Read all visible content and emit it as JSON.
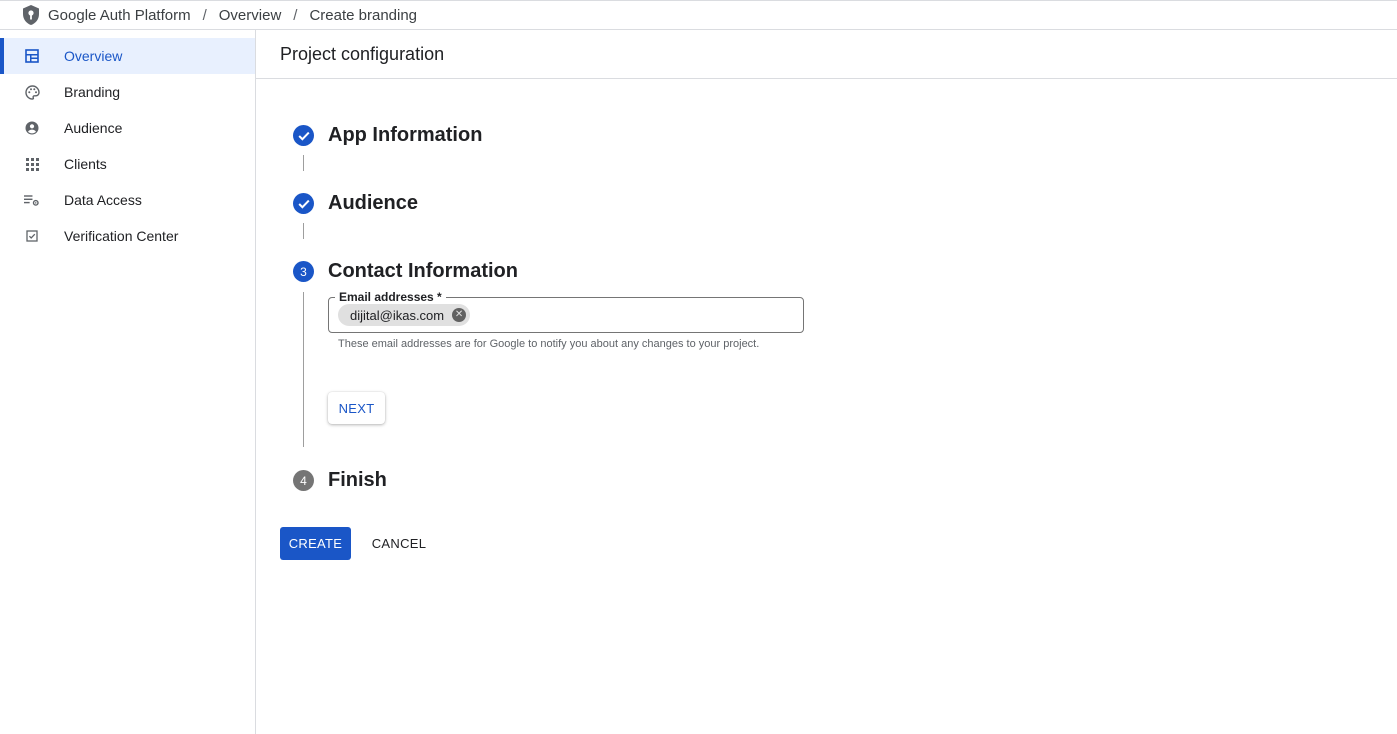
{
  "breadcrumb": {
    "items": [
      "Google Auth Platform",
      "Overview",
      "Create branding"
    ],
    "separator": "/"
  },
  "sidebar": {
    "items": [
      {
        "label": "Overview",
        "icon": "dashboard-icon",
        "active": true
      },
      {
        "label": "Branding",
        "icon": "palette-icon",
        "active": false
      },
      {
        "label": "Audience",
        "icon": "account-circle-icon",
        "active": false
      },
      {
        "label": "Clients",
        "icon": "apps-grid-icon",
        "active": false
      },
      {
        "label": "Data Access",
        "icon": "list-settings-icon",
        "active": false
      },
      {
        "label": "Verification Center",
        "icon": "checkbox-icon",
        "active": false
      }
    ]
  },
  "main": {
    "title": "Project configuration",
    "steps": [
      {
        "title": "App Information",
        "status": "done"
      },
      {
        "title": "Audience",
        "status": "done"
      },
      {
        "title": "Contact Information",
        "status": "current",
        "number": "3"
      },
      {
        "title": "Finish",
        "status": "todo",
        "number": "4"
      }
    ],
    "email_field": {
      "label": "Email addresses *",
      "chips": [
        "dijital@ikas.com"
      ],
      "hint": "These email addresses are for Google to notify you about any changes to your project."
    },
    "next_label": "NEXT",
    "create_label": "CREATE",
    "cancel_label": "CANCEL"
  },
  "colors": {
    "accent": "#1a56c7",
    "active_bg": "#e8f0fe",
    "todo_step": "#757575"
  }
}
